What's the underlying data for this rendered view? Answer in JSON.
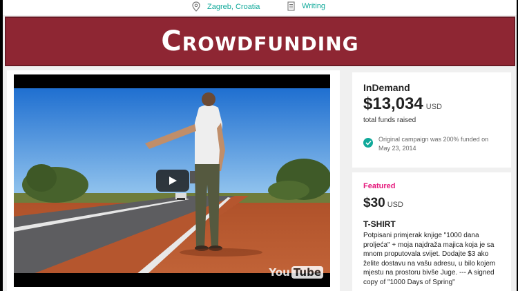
{
  "meta": {
    "location_icon": "location-pin-icon",
    "location": "Zagreb, Croatia",
    "category_icon": "document-icon",
    "category": "Writing"
  },
  "banner": {
    "title": "Crowdfunding"
  },
  "video": {
    "play_icon": "play-icon",
    "provider_prefix": "You",
    "provider_suffix": "Tube"
  },
  "funds": {
    "brand": "InDemand",
    "amount": "$13,034",
    "currency": "USD",
    "label": "total funds raised",
    "note_icon": "check-circle-icon",
    "note": "Original campaign was 200% funded on May 23, 2014"
  },
  "perk": {
    "badge": "Featured",
    "price": "$30",
    "currency": "USD",
    "title": "T-SHIRT",
    "description": "Potpisani primjerak knjige \"1000 dana proljeća\" + moja najdraža majica koja je sa mnom proputovala svijet.  Dodajte $3 ako želite dostavu na vašu adresu, u bilo kojem mjestu na prostoru bivše Juge.  --- A signed copy of \"1000 Days of Spring\""
  },
  "colors": {
    "accent": "#10a99a",
    "banner": "#8e2633",
    "featured": "#e5177b"
  }
}
